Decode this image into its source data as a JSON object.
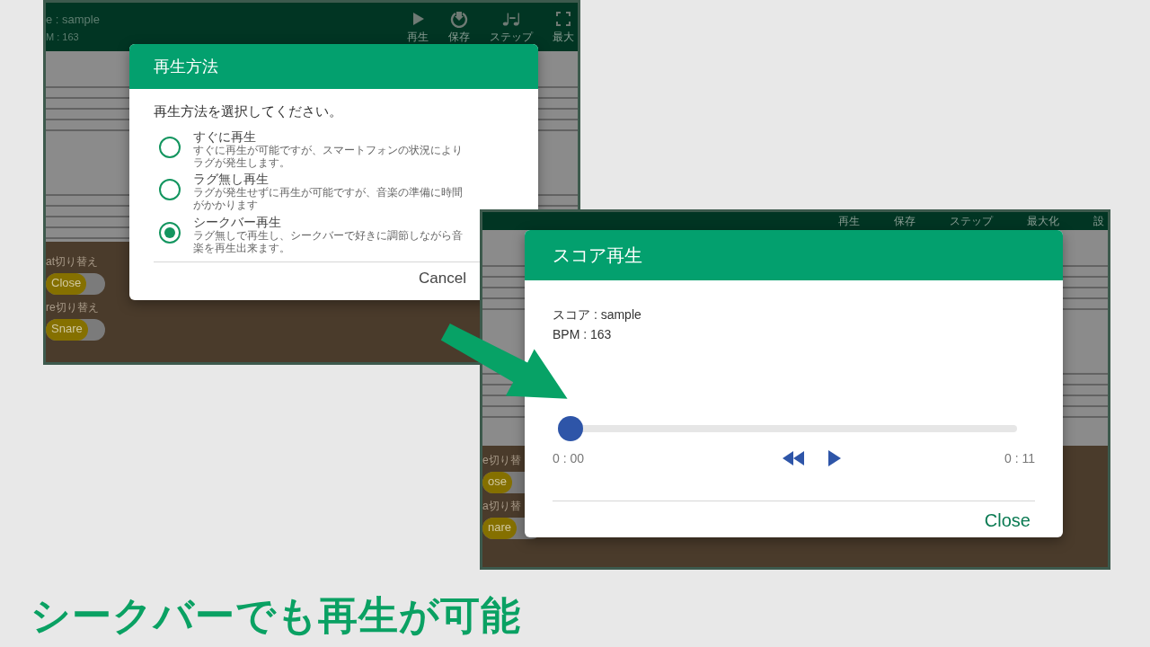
{
  "screen_1": {
    "score_title": "e : sample",
    "bpm": "M : 163",
    "toolbar": [
      {
        "label": "再生",
        "kind": "play"
      },
      {
        "label": "保存",
        "kind": "save"
      },
      {
        "label": "ステップ",
        "kind": "step"
      },
      {
        "label": "最大",
        "kind": "maximize"
      }
    ],
    "toggles": [
      {
        "label": "at切り替え",
        "value": "Close",
        "on": true
      },
      {
        "label": "re切り替え",
        "value": "Snare",
        "on": true
      }
    ],
    "dialog": {
      "title": "再生方法",
      "prompt": "再生方法を選択してください。",
      "options": [
        {
          "label": "すぐに再生",
          "description": "すぐに再生が可能ですが、スマートフォンの状況によりラグが発生します。",
          "selected": false
        },
        {
          "label": "ラグ無し再生",
          "description": "ラグが発生せずに再生が可能ですが、音楽の準備に時間がかかります",
          "selected": false
        },
        {
          "label": "シークバー再生",
          "description": "ラグ無しで再生し、シークバーで好きに調節しながら音楽を再生出来ます。",
          "selected": true
        }
      ],
      "buttons": [
        "Cancel"
      ]
    }
  },
  "screen_2": {
    "toolbar": [
      "再生",
      "保存",
      "ステップ",
      "最大化",
      "設"
    ],
    "toggles": [
      {
        "label": "e切り替",
        "value": "ose",
        "on": true
      },
      {
        "label": "a切り替",
        "value": "nare",
        "on": true
      }
    ],
    "dialog": {
      "title": "スコア再生",
      "score": "スコア : sample",
      "bpm": "BPM : 163",
      "seek": {
        "level": 0
      },
      "elapsed": "0 : 00",
      "total": "0 : 11",
      "buttons": [
        "Close"
      ]
    }
  },
  "caption": "シークバーでも再生が可能"
}
